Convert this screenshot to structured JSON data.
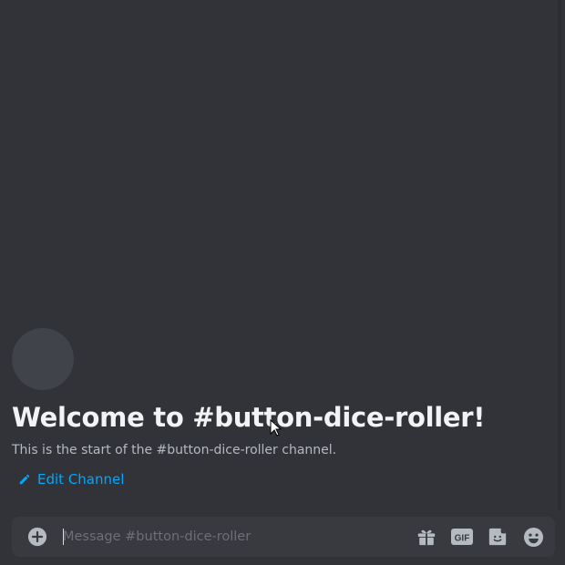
{
  "welcome": {
    "title": "Welcome to #button-dice-roller!",
    "subtitle": "This is the start of the #button-dice-roller channel.",
    "edit_label": "Edit Channel"
  },
  "composer": {
    "placeholder": "Message #button-dice-roller",
    "value": "",
    "icons": [
      "add-circle-icon",
      "gift-icon",
      "gif-icon",
      "sticker-icon",
      "emoji-icon"
    ]
  },
  "colors": {
    "background": "#313338",
    "composer_bg": "#383a40",
    "link": "#00a8fc",
    "title": "#f2f3f5",
    "subtitle": "#b5bac1",
    "icon": "#b5bac1"
  }
}
